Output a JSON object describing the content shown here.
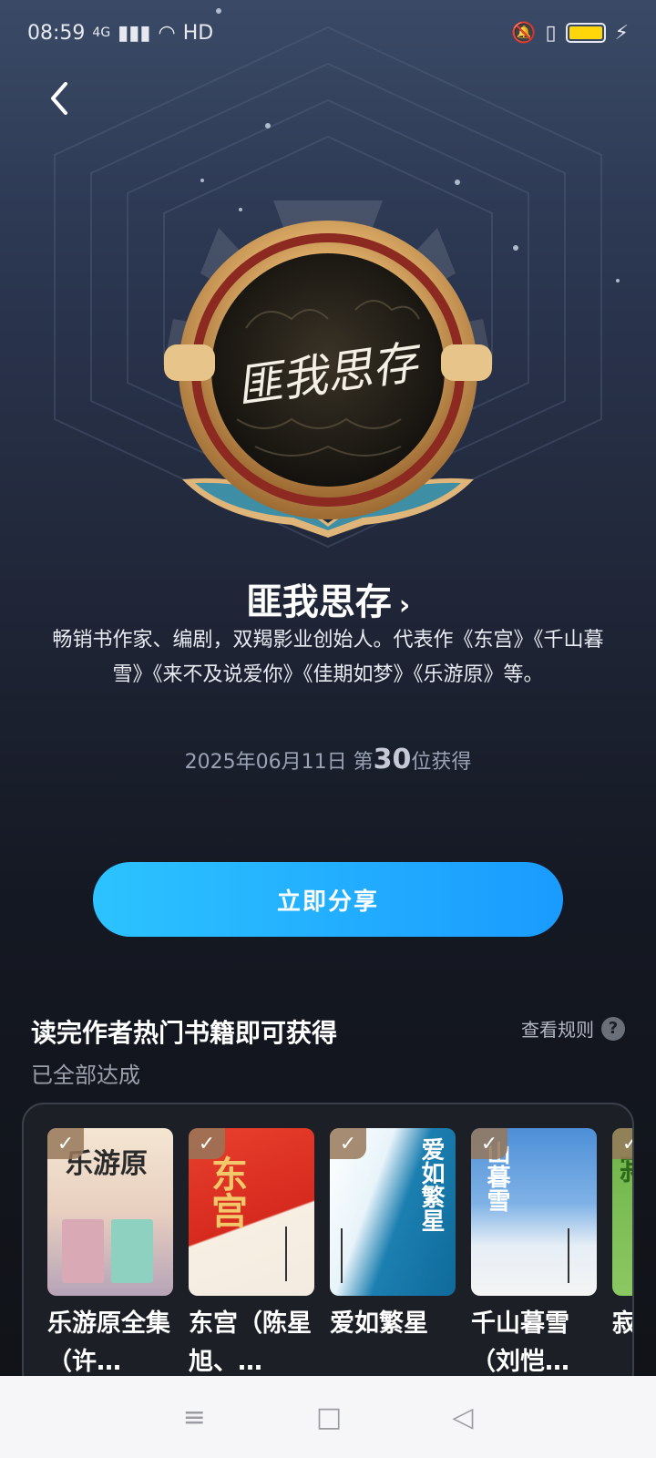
{
  "status_bar": {
    "time": "08:59",
    "network": "4G",
    "hd": "HD",
    "battery_color": "#ffd60a"
  },
  "header": {
    "back_icon": "back-chevron-icon"
  },
  "badge": {
    "signature_text": "匪我思存"
  },
  "author": {
    "name": "匪我思存",
    "description": "畅销书作家、编剧，双羯影业创始人。代表作《东宫》《千山暮雪》《来不及说爱你》《佳期如梦》《乐游原》等。",
    "obtained_date": "2025年06月11日",
    "rank_prefix": "第",
    "rank_number": "30",
    "rank_suffix": "位获得"
  },
  "share_button": {
    "label": "立即分享",
    "color": "#1a9bff"
  },
  "section": {
    "title": "读完作者热门书籍即可获得",
    "subtitle": "已全部达成",
    "rules_label": "查看规则",
    "help_icon": "?"
  },
  "books": [
    {
      "title": "乐游原全集（许…",
      "cover_text": "乐游原",
      "completed": true
    },
    {
      "title": "东宫（陈星旭、…",
      "cover_text": "东宫",
      "completed": true
    },
    {
      "title": "爱如繁星",
      "cover_text": "爱如繁星",
      "completed": true
    },
    {
      "title": "千山暮雪（刘恺…",
      "cover_text": "山暮雪",
      "completed": true
    },
    {
      "title": "寂寞春…",
      "cover_text": "寂",
      "completed": true
    }
  ],
  "nav_bar": {
    "menu_icon": "≡",
    "home_icon": "□",
    "back_icon": "◁"
  }
}
